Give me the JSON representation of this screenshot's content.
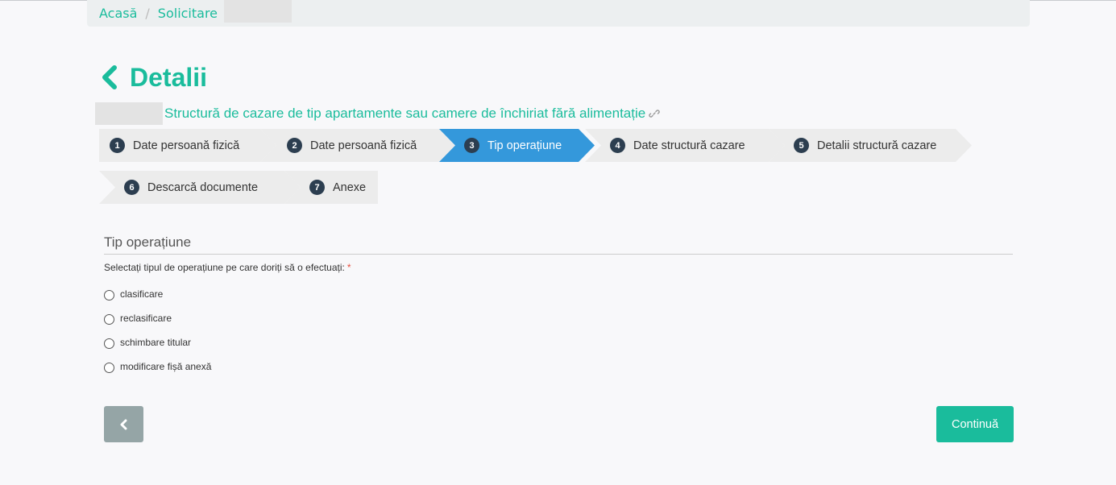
{
  "breadcrumb": {
    "home": "Acasă",
    "separator": "/",
    "current": "Solicitare"
  },
  "page": {
    "title": "Detalii",
    "subtitle": "Structură de cazare de tip apartamente sau camere de închiriat fără alimentație"
  },
  "steps": [
    {
      "num": "1",
      "label": "Date persoană fizică"
    },
    {
      "num": "2",
      "label": "Date persoană fizică"
    },
    {
      "num": "3",
      "label": "Tip operațiune"
    },
    {
      "num": "4",
      "label": "Date structură cazare"
    },
    {
      "num": "5",
      "label": "Detalii structură cazare"
    },
    {
      "num": "6",
      "label": "Descarcă documente"
    },
    {
      "num": "7",
      "label": "Anexe"
    }
  ],
  "section": {
    "title": "Tip operațiune",
    "question": "Selectați tipul de operațiune pe care doriți să o efectuați:",
    "required_mark": "*",
    "options": [
      "clasificare",
      "reclasificare",
      "schimbare titular",
      "modificare fișă anexă"
    ]
  },
  "actions": {
    "continue_label": "Continuă"
  },
  "colors": {
    "accent": "#1abc9c",
    "active_step": "#3498db",
    "step_bg": "#ececec",
    "back_button": "#95a5a6"
  }
}
